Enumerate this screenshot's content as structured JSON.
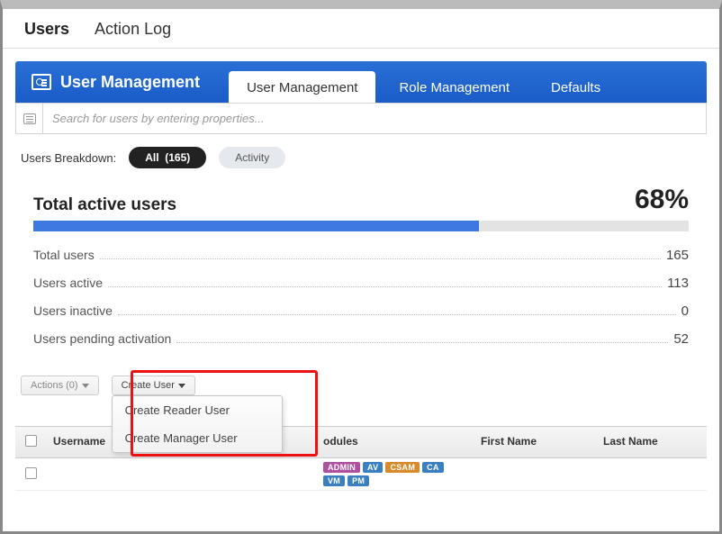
{
  "top_tabs": {
    "users": "Users",
    "action_log": "Action Log"
  },
  "header": {
    "title": "User Management",
    "tabs": {
      "user_mgmt": "User Management",
      "role_mgmt": "Role Management",
      "defaults": "Defaults"
    }
  },
  "search": {
    "placeholder": "Search for users by entering properties..."
  },
  "breakdown": {
    "label": "Users Breakdown:",
    "all_label": "All",
    "all_count": "(165)",
    "activity_label": "Activity"
  },
  "stats": {
    "title": "Total active users",
    "percent": "68%",
    "percent_value": 68,
    "rows": [
      {
        "label": "Total users",
        "value": "165"
      },
      {
        "label": "Users active",
        "value": "113"
      },
      {
        "label": "Users inactive",
        "value": "0"
      },
      {
        "label": "Users pending activation",
        "value": "52"
      }
    ]
  },
  "actions": {
    "actions_btn": "Actions (0)",
    "create_user_btn": "Create User",
    "menu": [
      "Create Reader User",
      "Create Manager User"
    ]
  },
  "table": {
    "columns": {
      "username": "Username",
      "modules": "odules",
      "first_name": "First Name",
      "last_name": "Last Name"
    },
    "row0": {
      "badges": [
        {
          "text": "ADMIN",
          "color": "#b050a0"
        },
        {
          "text": "AV",
          "color": "#3a7fbf"
        },
        {
          "text": "CSAM",
          "color": "#d98a2b"
        },
        {
          "text": "CA",
          "color": "#3a7fbf"
        },
        {
          "text": "VM",
          "color": "#3a7fbf"
        },
        {
          "text": "PM",
          "color": "#3a7fbf"
        }
      ]
    }
  }
}
